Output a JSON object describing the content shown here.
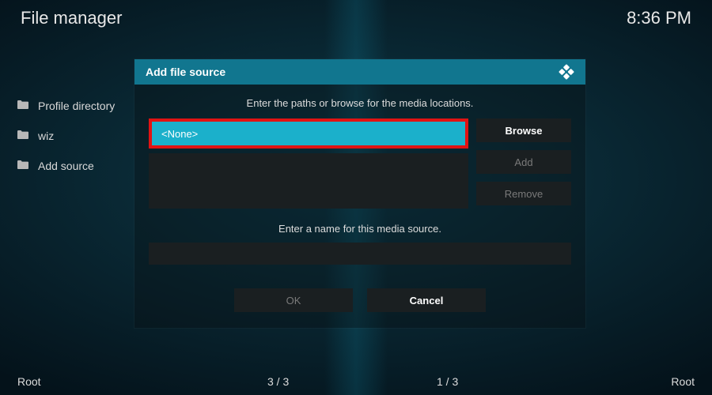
{
  "header": {
    "title": "File manager",
    "clock": "8:36 PM"
  },
  "sidebar": {
    "items": [
      {
        "icon": "folder-icon",
        "label": "Profile directory"
      },
      {
        "icon": "folder-icon",
        "label": "wiz"
      },
      {
        "icon": "folder-icon",
        "label": "Add source"
      }
    ]
  },
  "dialog": {
    "title": "Add file source",
    "instruction_paths": "Enter the paths or browse for the media locations.",
    "path_value": "<None>",
    "browse_label": "Browse",
    "add_label": "Add",
    "remove_label": "Remove",
    "instruction_name": "Enter a name for this media source.",
    "name_value": "",
    "ok_label": "OK",
    "cancel_label": "Cancel"
  },
  "footer": {
    "left_label": "Root",
    "left_count": "3 / 3",
    "right_count": "1 / 3",
    "right_label": "Root"
  }
}
